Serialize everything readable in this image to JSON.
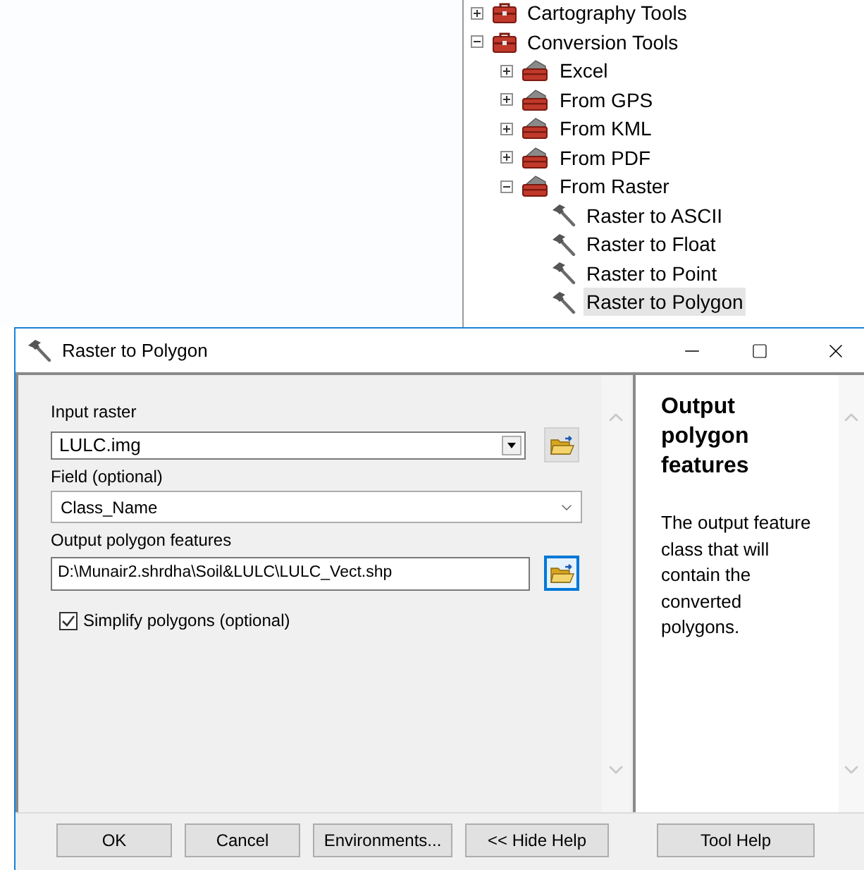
{
  "tree": {
    "items": [
      {
        "label": "Cartography Tools",
        "kind": "toolbox",
        "expanded": false,
        "selected": false
      },
      {
        "label": "Conversion Tools",
        "kind": "toolbox",
        "expanded": true,
        "selected": false,
        "children": [
          {
            "label": "Excel",
            "kind": "toolset",
            "expanded": false,
            "selected": false
          },
          {
            "label": "From GPS",
            "kind": "toolset",
            "expanded": false,
            "selected": false
          },
          {
            "label": "From KML",
            "kind": "toolset",
            "expanded": false,
            "selected": false
          },
          {
            "label": "From PDF",
            "kind": "toolset",
            "expanded": false,
            "selected": false
          },
          {
            "label": "From Raster",
            "kind": "toolset",
            "expanded": true,
            "selected": false,
            "children": [
              {
                "label": "Raster to ASCII",
                "kind": "tool",
                "selected": false
              },
              {
                "label": "Raster to Float",
                "kind": "tool",
                "selected": false
              },
              {
                "label": "Raster to Point",
                "kind": "tool",
                "selected": false
              },
              {
                "label": "Raster to Polygon",
                "kind": "tool",
                "selected": true
              }
            ]
          }
        ]
      }
    ]
  },
  "dialog": {
    "title": "Raster to Polygon",
    "parameters": [
      {
        "kind": "combo",
        "label": "Input raster",
        "value": "LULC.img",
        "browse_focused": false
      },
      {
        "kind": "select",
        "label": "Field (optional)",
        "value": "Class_Name"
      },
      {
        "kind": "path",
        "label": "Output polygon features",
        "value": "D:\\Munair2.shrdha\\Soil&LULC\\LULC_Vect.shp",
        "browse_focused": true
      },
      {
        "kind": "checkbox",
        "label": "Simplify polygons (optional)",
        "checked": true
      }
    ],
    "help": {
      "title": "Output polygon features",
      "text": "The output feature class that will contain the converted polygons."
    },
    "buttons": [
      "OK",
      "Cancel",
      "Environments...",
      "<< Hide Help",
      "Tool Help"
    ]
  }
}
